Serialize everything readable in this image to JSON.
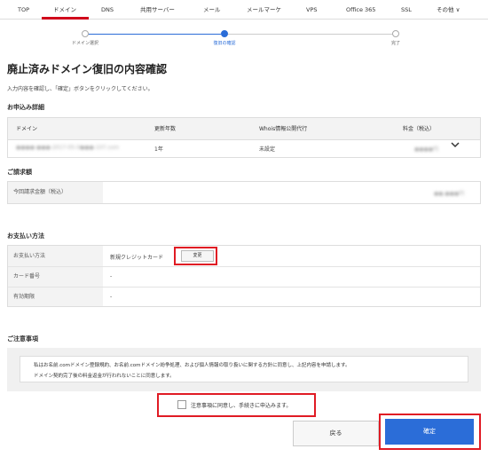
{
  "nav": {
    "items": [
      "TOP",
      "ドメイン",
      "DNS",
      "共用サーバー",
      "メール",
      "メールマーケ",
      "VPS",
      "Office 365",
      "SSL",
      "その他 ∨"
    ],
    "active_index": 1
  },
  "stepper": {
    "steps": [
      "ドメイン選択",
      "復旧の確認",
      "完了"
    ],
    "current": 1
  },
  "page": {
    "title": "廃止済みドメイン復旧の内容確認",
    "description": "入力内容を確認し、「確定」ボタンをクリックしてください。"
  },
  "order": {
    "section_title": "お申込み詳細",
    "columns": [
      "ドメイン",
      "更新年数",
      "Whois情報公開代行",
      "料金（税込）"
    ],
    "row": {
      "domain": "●●●●-●●●-2017-05-0●●●-107.com",
      "years": "1年",
      "whois": "未設定",
      "price": "●●●●円"
    }
  },
  "billing": {
    "section_title": "ご請求額",
    "label": "今回請求金額（税込）",
    "amount": "●●,●●●円"
  },
  "payment": {
    "section_title": "お支払い方法",
    "rows": [
      {
        "label": "お支払い方法",
        "value": "新規クレジットカード"
      },
      {
        "label": "カード番号",
        "value": "-"
      },
      {
        "label": "有効期限",
        "value": "-"
      }
    ],
    "change_label": "変更"
  },
  "notice": {
    "section_title": "ご注意事項",
    "lines": [
      "私はお名前.comドメイン登録規約、お名前.comドメイン紛争処理、および個人情報の取り扱いに関する方針に同意し、上記内容を申請します。",
      "ドメイン契約完了後の料金返金が行われないことに同意します。"
    ]
  },
  "agree": {
    "label": "注意事項に同意し、手続きに申込みます。",
    "checked": false
  },
  "buttons": {
    "back": "戻る",
    "confirm": "確定"
  },
  "colors": {
    "accent": "#2b6dd8",
    "nav_active": "#d0021b",
    "highlight": "#e01b24"
  }
}
